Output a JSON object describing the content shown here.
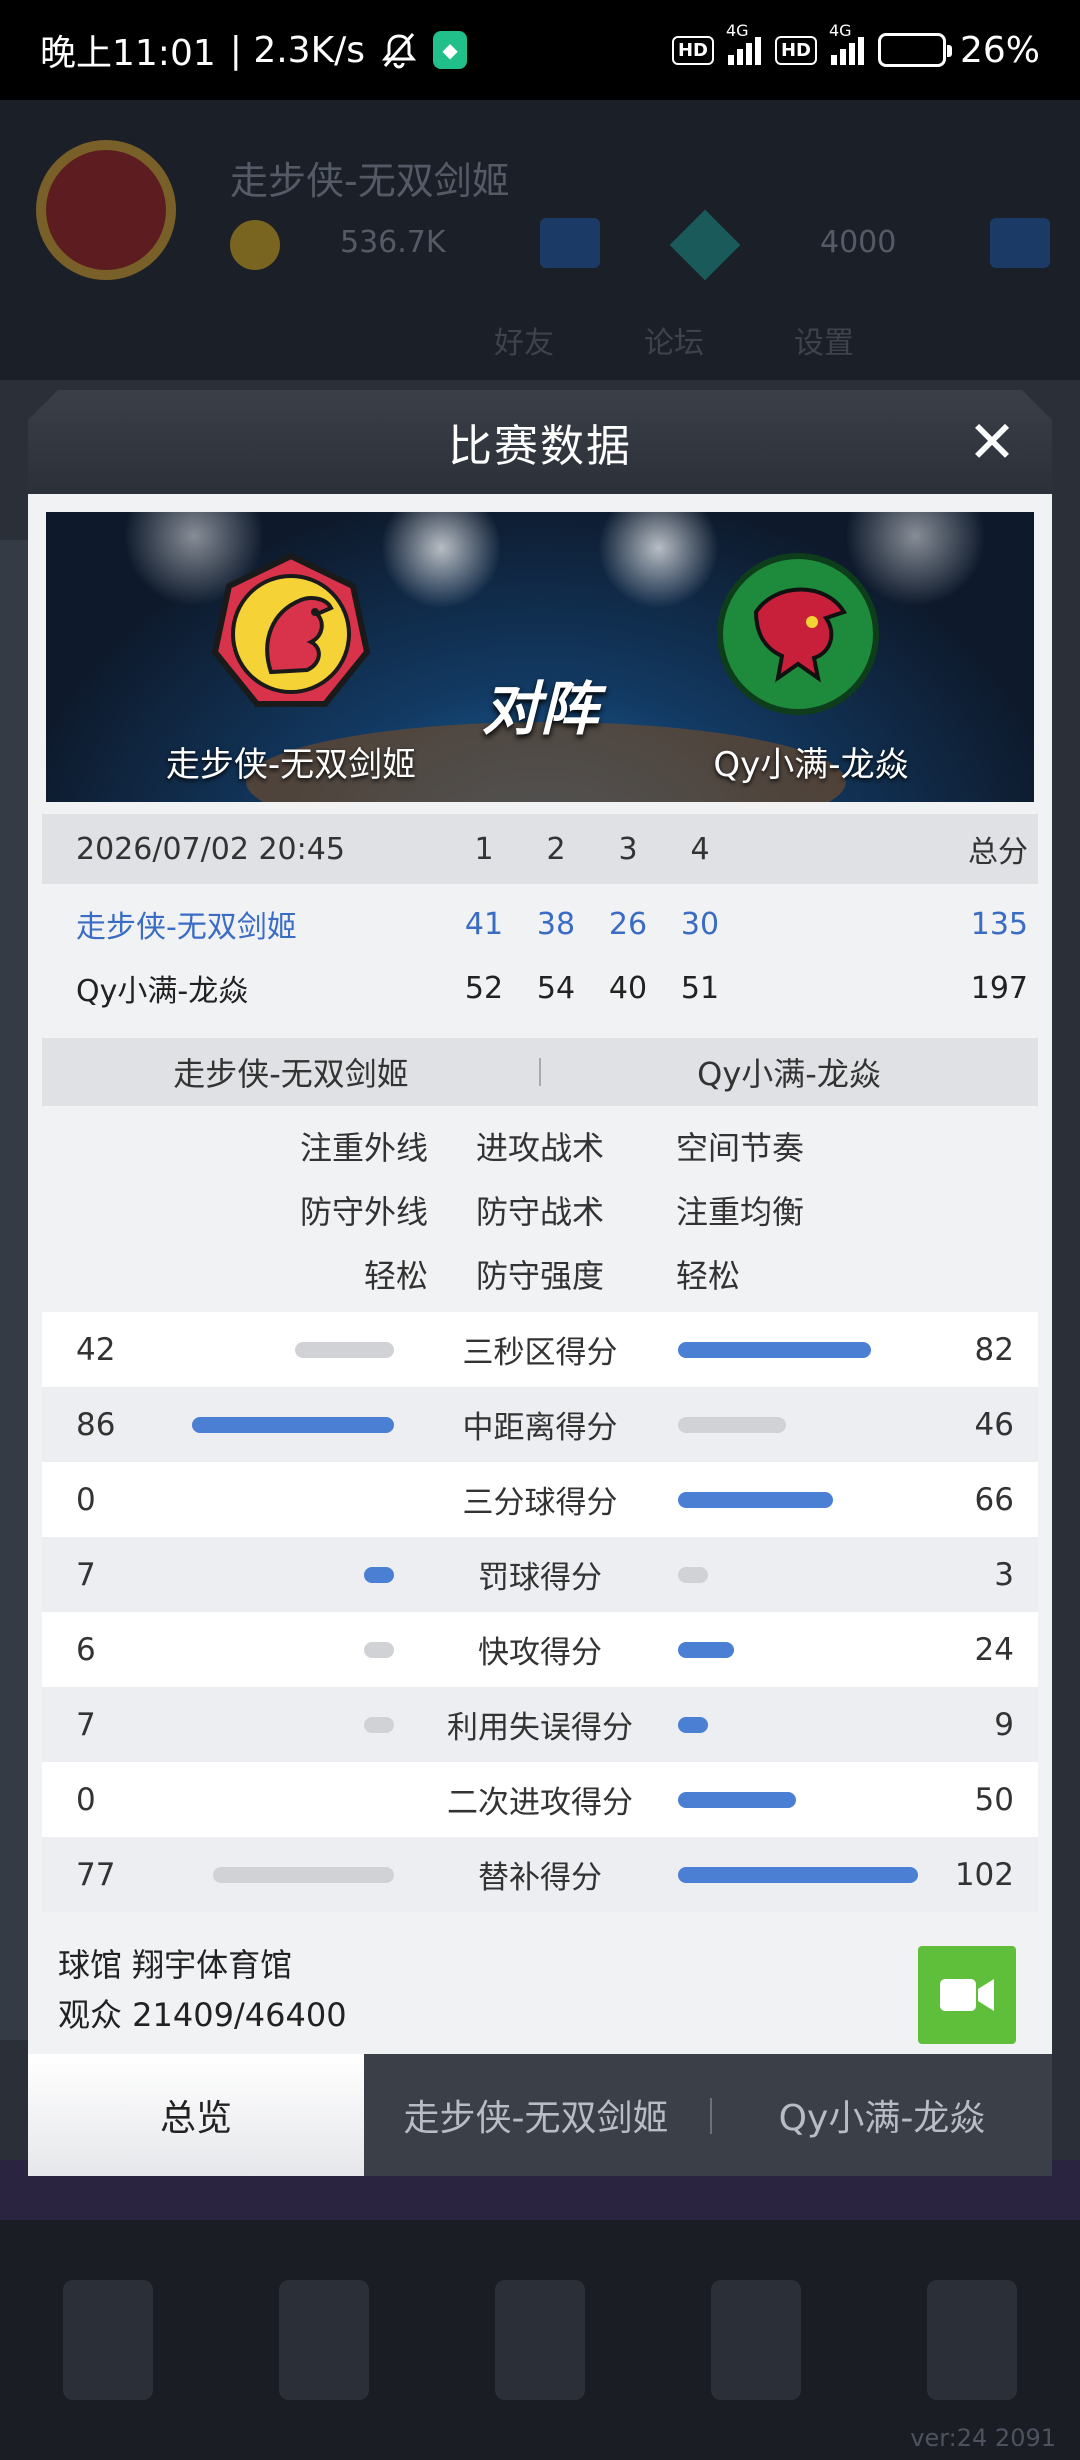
{
  "status_bar": {
    "time": "晚上11:01",
    "speed": "| 2.3K/s",
    "sim1_hd": "HD",
    "sim1_net": "4G",
    "sim2_hd": "HD",
    "sim2_net": "4G",
    "battery": "26%",
    "battery_level": 0.26
  },
  "background": {
    "team_name": "走步侠-无双剑姬",
    "coins": "536.7K",
    "gems": "4000",
    "toolbar": [
      "",
      "好友",
      "论坛",
      "设置"
    ],
    "version": "ver:24  2091"
  },
  "modal": {
    "title": "比赛数据",
    "close_symbol": "✕",
    "hero": {
      "vs_text": "对阵",
      "home_name": "走步侠-无双剑姬",
      "away_name": "Qy小满-龙焱"
    },
    "score_table": {
      "date": "2026/07/02 20:45",
      "quarters": [
        "1",
        "2",
        "3",
        "4"
      ],
      "total_label": "总分",
      "home": {
        "name": "走步侠-无双剑姬",
        "quarters": [
          "41",
          "38",
          "26",
          "30"
        ],
        "total": "135"
      },
      "away": {
        "name": "Qy小满-龙焱",
        "quarters": [
          "52",
          "54",
          "40",
          "51"
        ],
        "total": "197"
      }
    },
    "tactics": {
      "home_name": "走步侠-无双剑姬",
      "away_name": "Qy小满-龙焱",
      "rows": [
        {
          "home": "注重外线",
          "label": "进攻战术",
          "away": "空间节奏"
        },
        {
          "home": "防守外线",
          "label": "防守战术",
          "away": "注重均衡"
        },
        {
          "home": "轻松",
          "label": "防守强度",
          "away": "轻松"
        }
      ]
    },
    "stats": [
      {
        "label": "三秒区得分",
        "home": 42,
        "away": 82
      },
      {
        "label": "中距离得分",
        "home": 86,
        "away": 46
      },
      {
        "label": "三分球得分",
        "home": 0,
        "away": 66
      },
      {
        "label": "罚球得分",
        "home": 7,
        "away": 3
      },
      {
        "label": "快攻得分",
        "home": 6,
        "away": 24
      },
      {
        "label": "利用失误得分",
        "home": 7,
        "away": 9
      },
      {
        "label": "二次进攻得分",
        "home": 0,
        "away": 50
      },
      {
        "label": "替补得分",
        "home": 77,
        "away": 102
      }
    ],
    "venue": {
      "arena": "球馆 翔宇体育馆",
      "attendance": "观众 21409/46400"
    },
    "tabs": [
      "总览",
      "走步侠-无双剑姬",
      "Qy小满-龙焱"
    ],
    "colors": {
      "win_bar": "#4a7fd4",
      "lose_bar": "#d0d2d6",
      "home_text": "#3b6cc4",
      "video_button": "#5fbf3a"
    }
  }
}
